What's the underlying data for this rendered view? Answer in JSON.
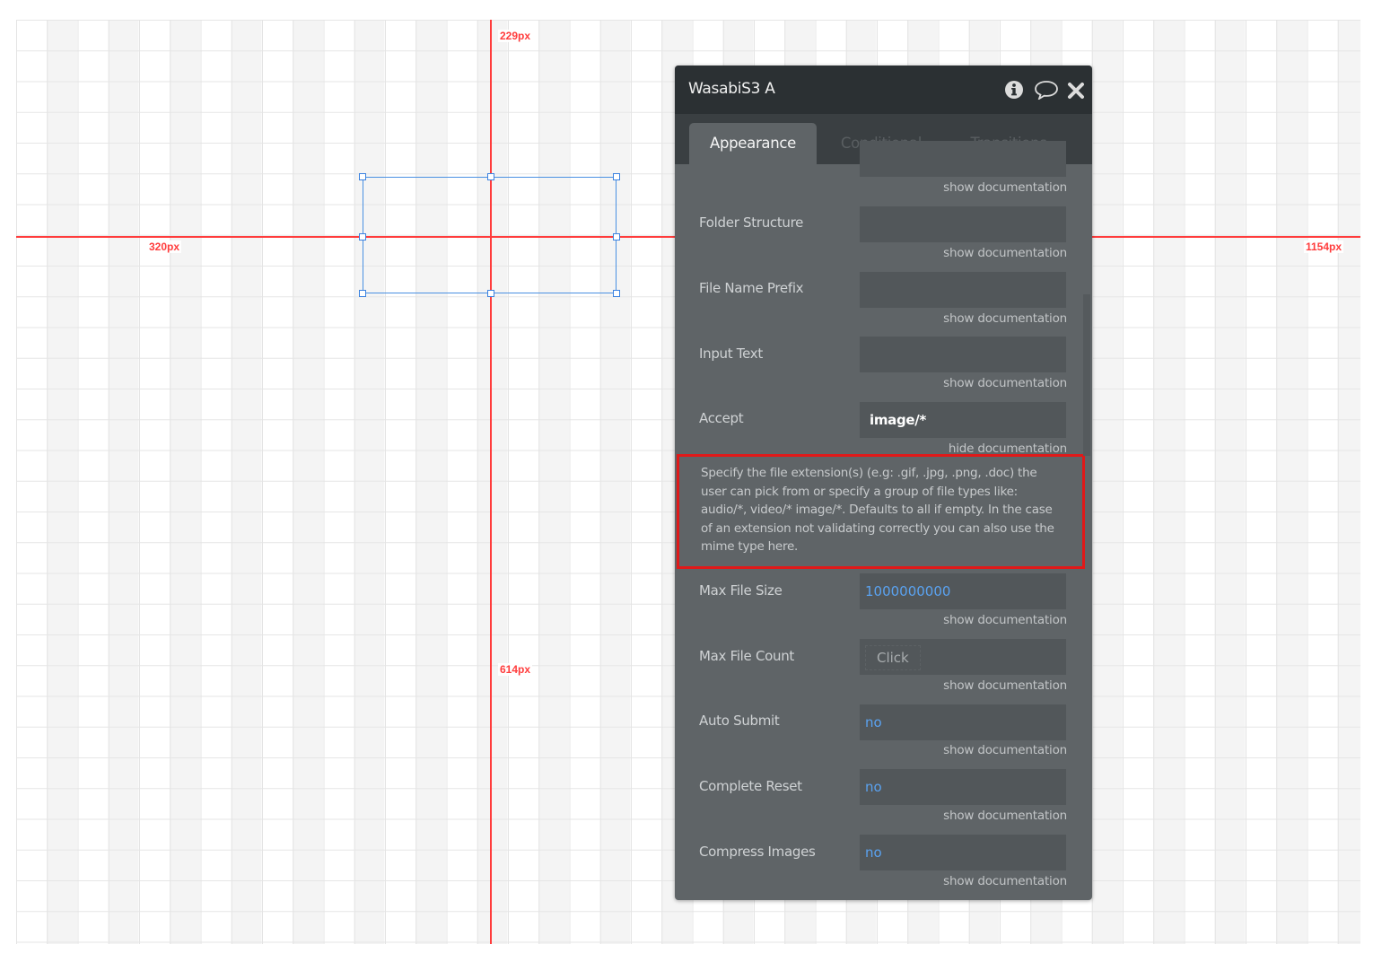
{
  "canvas": {
    "guides": {
      "top_distance": "229px",
      "bottom_distance": "614px",
      "left_distance": "320px",
      "right_distance": "1154px"
    },
    "colors": {
      "guide": "#ff3c3c",
      "selection": "#4a90e2"
    }
  },
  "panel": {
    "title": "WasabiS3 A",
    "header_icons": [
      "info-icon",
      "comment-icon",
      "close-icon"
    ],
    "tabs": [
      {
        "label": "Appearance",
        "active": true
      },
      {
        "label": "Conditional",
        "active": false
      },
      {
        "label": "Transitions",
        "active": false
      }
    ],
    "top_doc_link": "show documentation",
    "fields": [
      {
        "label": "Folder Structure",
        "value": "",
        "doc": "show documentation"
      },
      {
        "label": "File Name Prefix",
        "value": "",
        "doc": "show documentation"
      },
      {
        "label": "Input Text",
        "value": "",
        "doc": "show documentation"
      },
      {
        "label": "Accept",
        "value": "image/*",
        "doc": "hide documentation"
      },
      {
        "label": "Max File Size",
        "value": "1000000000",
        "doc": "show documentation"
      },
      {
        "label": "Max File Count",
        "value": "Click",
        "doc": "show documentation"
      },
      {
        "label": "Auto Submit",
        "value": "no",
        "doc": "show documentation"
      },
      {
        "label": "Complete Reset",
        "value": "no",
        "doc": "show documentation"
      },
      {
        "label": "Compress Images",
        "value": "no",
        "doc": "show documentation"
      }
    ],
    "accept_documentation": "Specify the file extension(s) (e.g: .gif, .jpg, .png, .doc) the user can pick from or specify a group of file types like: audio/*, video/* image/*. Defaults to all if empty. In the case of an extension not validating correctly you can also use the mime type here.",
    "colors": {
      "header": "#2b3033",
      "tabbar": "#3a3f42",
      "body": "#5f6467",
      "input": "#52575a",
      "link_value": "#5aa2f0",
      "highlight": "#e01919"
    }
  }
}
